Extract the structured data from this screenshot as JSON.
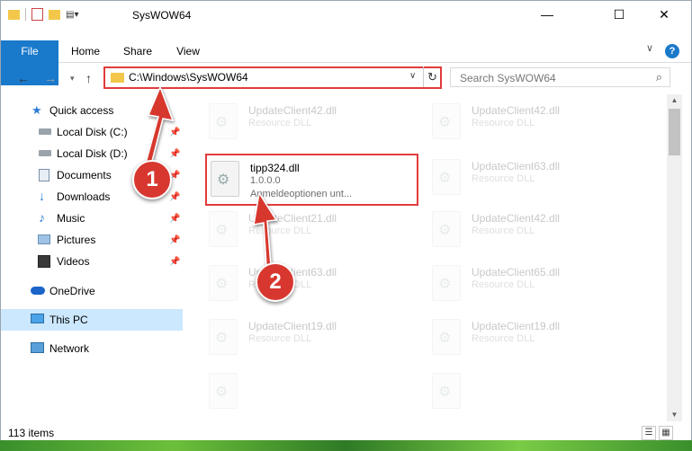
{
  "window": {
    "title": "SysWOW64"
  },
  "ribbon": {
    "tabs": [
      "File",
      "Home",
      "Share",
      "View"
    ],
    "help": "?"
  },
  "address": {
    "path": "C:\\Windows\\SysWOW64",
    "refresh": "↻"
  },
  "search": {
    "placeholder": "Search SysWOW64"
  },
  "sidebar": {
    "items": [
      {
        "label": "Quick access",
        "icon": "star-icon"
      },
      {
        "label": "Local Disk (C:)",
        "icon": "drive-icon"
      },
      {
        "label": "Local Disk (D:)",
        "icon": "drive-icon"
      },
      {
        "label": "Documents",
        "icon": "documents-icon"
      },
      {
        "label": "Downloads",
        "icon": "download-icon"
      },
      {
        "label": "Music",
        "icon": "music-icon"
      },
      {
        "label": "Pictures",
        "icon": "pictures-icon"
      },
      {
        "label": "Videos",
        "icon": "videos-icon"
      },
      {
        "label": "OneDrive",
        "icon": "cloud-icon"
      },
      {
        "label": "This PC",
        "icon": "computer-icon"
      },
      {
        "label": "Network",
        "icon": "network-icon"
      }
    ]
  },
  "files": [
    {
      "name": "UpdateClient42.dll",
      "desc": "Resource DLL"
    },
    {
      "name": "UpdateClient42.dll",
      "desc": "Resource DLL"
    },
    {
      "name": "tipp324.dll",
      "desc": "1.0.0.0",
      "desc2": "Anmeldeoptionen unt..."
    },
    {
      "name": "UpdateClient63.dll",
      "desc": "Resource DLL"
    },
    {
      "name": "UpdateClient21.dll",
      "desc": "Resource DLL"
    },
    {
      "name": "UpdateClient42.dll",
      "desc": "Resource DLL"
    },
    {
      "name": "UpdateClient63.dll",
      "desc": "Resource DLL"
    },
    {
      "name": "UpdateClient65.dll",
      "desc": "Resource DLL"
    },
    {
      "name": "UpdateClient19.dll",
      "desc": "Resource DLL"
    },
    {
      "name": "UpdateClient19.dll",
      "desc": "Resource DLL"
    }
  ],
  "status": {
    "count": "113 items"
  },
  "annotations": {
    "step1": "1",
    "step2": "2",
    "color": "#d7372f"
  }
}
